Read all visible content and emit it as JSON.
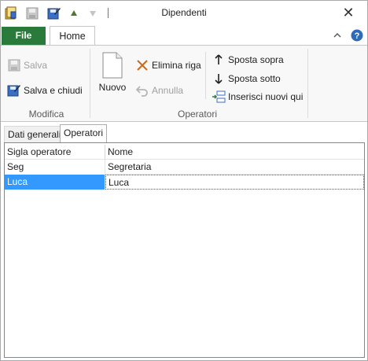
{
  "window": {
    "title": "Dipendenti"
  },
  "ribbon_tabs": {
    "file": "File",
    "home": "Home"
  },
  "ribbon": {
    "modifica": {
      "label": "Modifica",
      "salva": "Salva",
      "salva_chiudi": "Salva e chiudi"
    },
    "operatori": {
      "label": "Operatori",
      "nuovo": "Nuovo",
      "elimina_riga": "Elimina riga",
      "annulla": "Annulla",
      "sposta_sopra": "Sposta sopra",
      "sposta_sotto": "Sposta sotto",
      "inserisci": "Inserisci nuovi qui"
    }
  },
  "content_tabs": [
    "Dati generali",
    "Operatori"
  ],
  "grid": {
    "columns": [
      "Sigla operatore",
      "Nome"
    ],
    "rows": [
      [
        "Seg",
        "Segretaria"
      ],
      [
        "Luca",
        "Luca"
      ]
    ]
  },
  "colors": {
    "file_tab": "#2a7a3b",
    "selection": "#3399ff"
  }
}
